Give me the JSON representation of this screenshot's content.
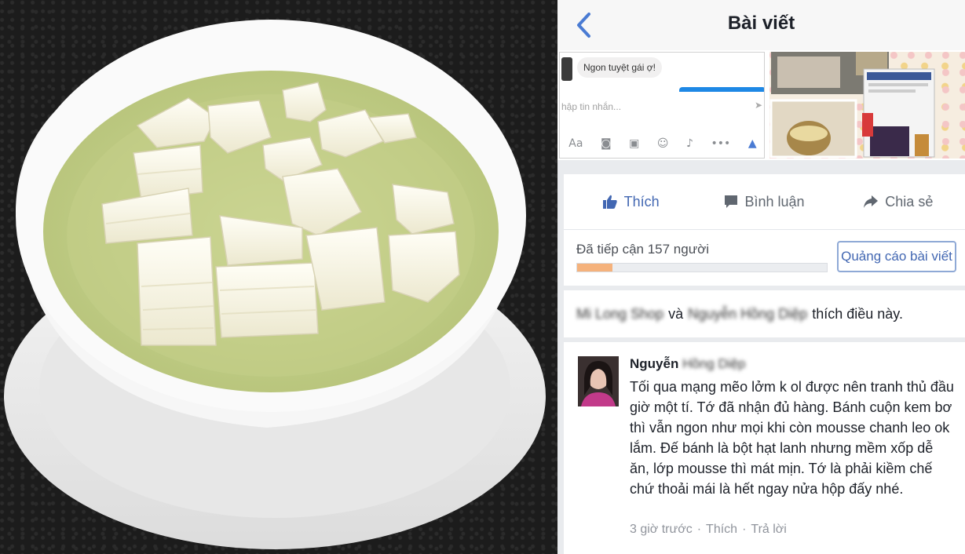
{
  "header": {
    "title": "Bài viết",
    "back_icon": "chevron-left-icon"
  },
  "chat_preview": {
    "message": "Ngon tuyệt gái ợ!",
    "input_placeholder": "hập tin nhắn...",
    "icons": [
      "Aa",
      "camera-icon",
      "gallery-icon",
      "emoji-icon",
      "mic-icon",
      "more-icon",
      "like-icon"
    ],
    "icon_glyphs": [
      "Aa",
      "◙",
      "▣",
      "☺",
      "♪",
      "•••",
      "▲"
    ]
  },
  "actions": {
    "like": "Thích",
    "comment": "Bình luận",
    "share": "Chia sẻ"
  },
  "reach": {
    "text": "Đã tiếp cận 157 người",
    "progress": 0.14,
    "boost_button": "Quảng cáo bài viết"
  },
  "likes": {
    "name1": "Mi Long Shop",
    "connector": "và",
    "name2": "Nguyễn Hồng Diệp",
    "suffix": "thích điều này."
  },
  "comment": {
    "author_first": "Nguyễn",
    "author_rest": "Hồng Diệp",
    "body": "Tối qua mạng mẽo lởm k ol được nên tranh thủ đầu giờ một tí. Tớ đã nhận đủ hàng. Bánh cuộn kem bơ thì vẫn ngon như mọi khi còn mousse chanh leo ok lắm. Đế bánh là bột hạt lanh nhưng mềm xốp dễ ăn, lớp mousse thì mát mịn. Tớ là phải kiềm chế chứ thoải mái là hết ngay nửa hộp đấy nhé.",
    "time": "3 giờ trước",
    "dot": "·",
    "like": "Thích",
    "reply": "Trả lời"
  },
  "colors": {
    "facebook_blue": "#4267b2",
    "reach_fill": "#f5b27c",
    "panel_bg": "#e9ebee"
  }
}
